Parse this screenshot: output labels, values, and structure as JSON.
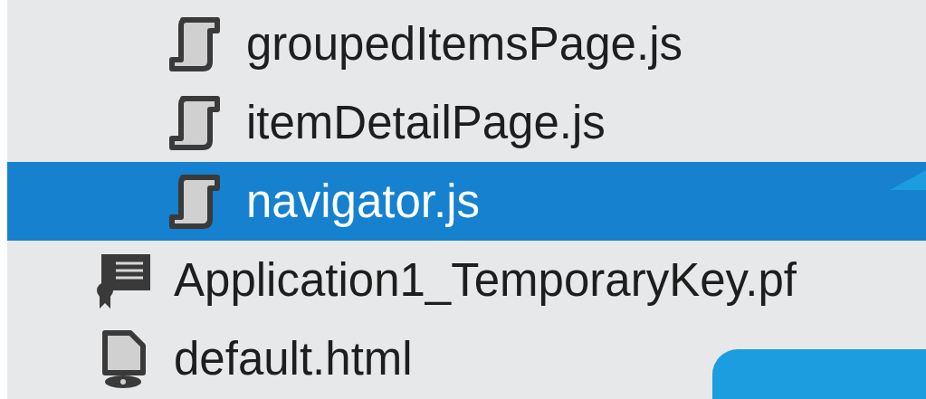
{
  "tree": [
    {
      "kind": "folder",
      "children": [
        {
          "name": "groupedItemsPage.js",
          "kind": "script",
          "selected": false
        },
        {
          "name": "itemDetailPage.js",
          "kind": "script",
          "selected": false
        },
        {
          "name": "navigator.js",
          "kind": "script",
          "selected": true
        }
      ]
    },
    {
      "name": "Application1_TemporaryKey.pf",
      "kind": "certificate",
      "selected": false
    },
    {
      "name": "default.html",
      "kind": "html",
      "selected": false
    }
  ]
}
